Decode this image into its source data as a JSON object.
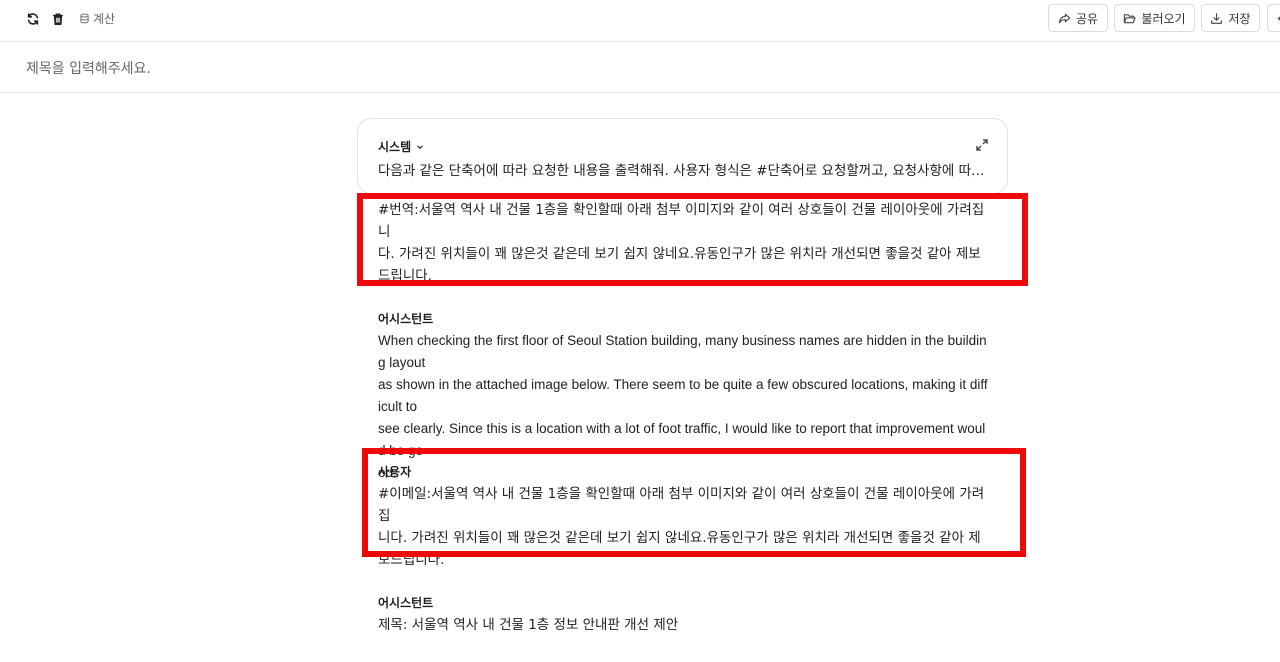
{
  "toolbar": {
    "calc_label": "계산",
    "share_label": "공유",
    "load_label": "불러오기",
    "save_label": "저장"
  },
  "title": {
    "placeholder": "제목을 입력해주세요."
  },
  "system": {
    "role": "시스템",
    "text": "다음과 같은 단축어에 따라 요청한 내용을 출력해줘. 사용자 형식은 #단축어로 요청할꺼고, 요청사항에 따라 작성해줘."
  },
  "messages": [
    {
      "role": "",
      "text": "#번역:서울역 역사 내 건물 1층을 확인할때 아래 첨부 이미지와 같이 여러 상호들이 건물 레이아웃에 가려집니\n다. 가려진 위치들이 꽤 많은것 같은데 보기 쉽지 않네요.유동인구가 많은 위치라 개선되면 좋을것 같아 제보\n드립니다."
    },
    {
      "role": "어시스턴트",
      "text": "When checking the first floor of Seoul Station building, many business names are hidden in the building layout\nas shown in the attached image below. There seem to be quite a few obscured locations, making it difficult to\nsee clearly. Since this is a location with a lot of foot traffic, I would like to report that improvement would be go\nod."
    },
    {
      "role": "사용자",
      "text": "#이메일:서울역 역사 내 건물 1층을 확인할때 아래 첨부 이미지와 같이 여러 상호들이 건물 레이아웃에 가려집\n니다. 가려진 위치들이 꽤 많은것 같은데 보기 쉽지 않네요.유동인구가 많은 위치라 개선되면 좋을것 같아 제\n보드립니다."
    },
    {
      "role": "어시스턴트",
      "text": "제목: 서울역 역사 내 건물 1층 정보 안내판 개선 제안"
    }
  ],
  "colors": {
    "highlight": "#ee0a0a",
    "border": "#e2e2e2"
  }
}
